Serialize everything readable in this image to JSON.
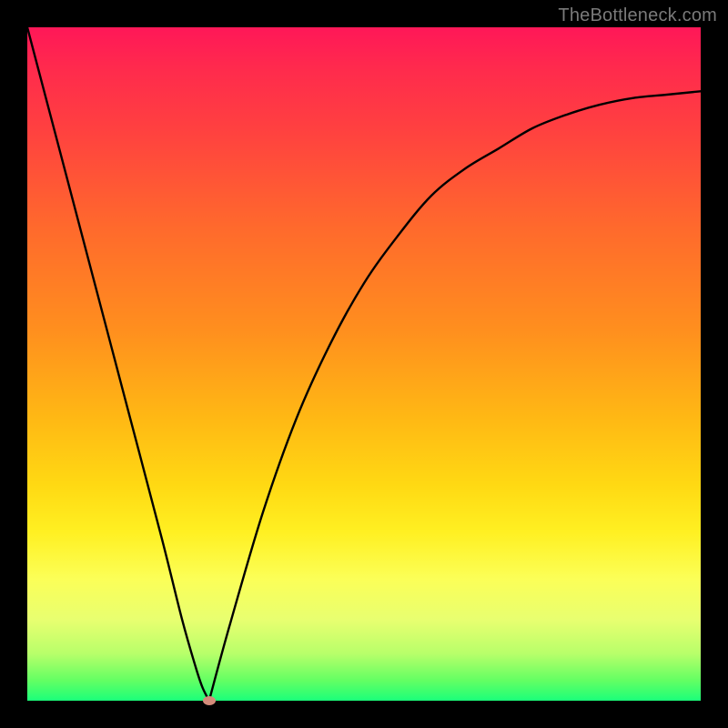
{
  "attribution": "TheBottleneck.com",
  "colors": {
    "frame": "#000000",
    "attribution_text": "#7a7a7a",
    "curve": "#000000",
    "dot": "#d38b7a",
    "gradient_top": "#ff1758",
    "gradient_mid1": "#ff8f1e",
    "gradient_mid2": "#fff022",
    "gradient_bottom": "#1bff7a"
  },
  "chart_data": {
    "type": "line",
    "title": "",
    "xlabel": "",
    "ylabel": "",
    "xlim": [
      0,
      100
    ],
    "ylim": [
      0,
      100
    ],
    "series": [
      {
        "name": "bottleneck-curve",
        "x": [
          0,
          5,
          10,
          15,
          20,
          23,
          25,
          26,
          27,
          30,
          35,
          40,
          45,
          50,
          55,
          60,
          65,
          70,
          75,
          80,
          85,
          90,
          95,
          100
        ],
        "values": [
          100,
          81,
          62,
          43,
          24,
          12,
          5,
          2,
          0,
          11,
          28,
          42,
          53,
          62,
          69,
          75,
          79,
          82,
          85,
          87,
          88.5,
          89.5,
          90,
          90.5
        ]
      }
    ],
    "annotations": [
      {
        "name": "minimum-point",
        "x": 27,
        "y": 0
      }
    ]
  }
}
